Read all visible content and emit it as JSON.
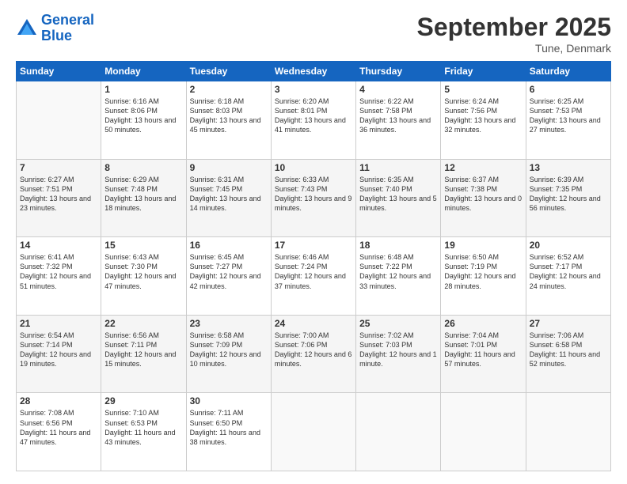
{
  "header": {
    "logo_line1": "General",
    "logo_line2": "Blue",
    "month": "September 2025",
    "location": "Tune, Denmark"
  },
  "days_of_week": [
    "Sunday",
    "Monday",
    "Tuesday",
    "Wednesday",
    "Thursday",
    "Friday",
    "Saturday"
  ],
  "weeks": [
    [
      {
        "day": "",
        "sunrise": "",
        "sunset": "",
        "daylight": ""
      },
      {
        "day": "1",
        "sunrise": "Sunrise: 6:16 AM",
        "sunset": "Sunset: 8:06 PM",
        "daylight": "Daylight: 13 hours and 50 minutes."
      },
      {
        "day": "2",
        "sunrise": "Sunrise: 6:18 AM",
        "sunset": "Sunset: 8:03 PM",
        "daylight": "Daylight: 13 hours and 45 minutes."
      },
      {
        "day": "3",
        "sunrise": "Sunrise: 6:20 AM",
        "sunset": "Sunset: 8:01 PM",
        "daylight": "Daylight: 13 hours and 41 minutes."
      },
      {
        "day": "4",
        "sunrise": "Sunrise: 6:22 AM",
        "sunset": "Sunset: 7:58 PM",
        "daylight": "Daylight: 13 hours and 36 minutes."
      },
      {
        "day": "5",
        "sunrise": "Sunrise: 6:24 AM",
        "sunset": "Sunset: 7:56 PM",
        "daylight": "Daylight: 13 hours and 32 minutes."
      },
      {
        "day": "6",
        "sunrise": "Sunrise: 6:25 AM",
        "sunset": "Sunset: 7:53 PM",
        "daylight": "Daylight: 13 hours and 27 minutes."
      }
    ],
    [
      {
        "day": "7",
        "sunrise": "Sunrise: 6:27 AM",
        "sunset": "Sunset: 7:51 PM",
        "daylight": "Daylight: 13 hours and 23 minutes."
      },
      {
        "day": "8",
        "sunrise": "Sunrise: 6:29 AM",
        "sunset": "Sunset: 7:48 PM",
        "daylight": "Daylight: 13 hours and 18 minutes."
      },
      {
        "day": "9",
        "sunrise": "Sunrise: 6:31 AM",
        "sunset": "Sunset: 7:45 PM",
        "daylight": "Daylight: 13 hours and 14 minutes."
      },
      {
        "day": "10",
        "sunrise": "Sunrise: 6:33 AM",
        "sunset": "Sunset: 7:43 PM",
        "daylight": "Daylight: 13 hours and 9 minutes."
      },
      {
        "day": "11",
        "sunrise": "Sunrise: 6:35 AM",
        "sunset": "Sunset: 7:40 PM",
        "daylight": "Daylight: 13 hours and 5 minutes."
      },
      {
        "day": "12",
        "sunrise": "Sunrise: 6:37 AM",
        "sunset": "Sunset: 7:38 PM",
        "daylight": "Daylight: 13 hours and 0 minutes."
      },
      {
        "day": "13",
        "sunrise": "Sunrise: 6:39 AM",
        "sunset": "Sunset: 7:35 PM",
        "daylight": "Daylight: 12 hours and 56 minutes."
      }
    ],
    [
      {
        "day": "14",
        "sunrise": "Sunrise: 6:41 AM",
        "sunset": "Sunset: 7:32 PM",
        "daylight": "Daylight: 12 hours and 51 minutes."
      },
      {
        "day": "15",
        "sunrise": "Sunrise: 6:43 AM",
        "sunset": "Sunset: 7:30 PM",
        "daylight": "Daylight: 12 hours and 47 minutes."
      },
      {
        "day": "16",
        "sunrise": "Sunrise: 6:45 AM",
        "sunset": "Sunset: 7:27 PM",
        "daylight": "Daylight: 12 hours and 42 minutes."
      },
      {
        "day": "17",
        "sunrise": "Sunrise: 6:46 AM",
        "sunset": "Sunset: 7:24 PM",
        "daylight": "Daylight: 12 hours and 37 minutes."
      },
      {
        "day": "18",
        "sunrise": "Sunrise: 6:48 AM",
        "sunset": "Sunset: 7:22 PM",
        "daylight": "Daylight: 12 hours and 33 minutes."
      },
      {
        "day": "19",
        "sunrise": "Sunrise: 6:50 AM",
        "sunset": "Sunset: 7:19 PM",
        "daylight": "Daylight: 12 hours and 28 minutes."
      },
      {
        "day": "20",
        "sunrise": "Sunrise: 6:52 AM",
        "sunset": "Sunset: 7:17 PM",
        "daylight": "Daylight: 12 hours and 24 minutes."
      }
    ],
    [
      {
        "day": "21",
        "sunrise": "Sunrise: 6:54 AM",
        "sunset": "Sunset: 7:14 PM",
        "daylight": "Daylight: 12 hours and 19 minutes."
      },
      {
        "day": "22",
        "sunrise": "Sunrise: 6:56 AM",
        "sunset": "Sunset: 7:11 PM",
        "daylight": "Daylight: 12 hours and 15 minutes."
      },
      {
        "day": "23",
        "sunrise": "Sunrise: 6:58 AM",
        "sunset": "Sunset: 7:09 PM",
        "daylight": "Daylight: 12 hours and 10 minutes."
      },
      {
        "day": "24",
        "sunrise": "Sunrise: 7:00 AM",
        "sunset": "Sunset: 7:06 PM",
        "daylight": "Daylight: 12 hours and 6 minutes."
      },
      {
        "day": "25",
        "sunrise": "Sunrise: 7:02 AM",
        "sunset": "Sunset: 7:03 PM",
        "daylight": "Daylight: 12 hours and 1 minute."
      },
      {
        "day": "26",
        "sunrise": "Sunrise: 7:04 AM",
        "sunset": "Sunset: 7:01 PM",
        "daylight": "Daylight: 11 hours and 57 minutes."
      },
      {
        "day": "27",
        "sunrise": "Sunrise: 7:06 AM",
        "sunset": "Sunset: 6:58 PM",
        "daylight": "Daylight: 11 hours and 52 minutes."
      }
    ],
    [
      {
        "day": "28",
        "sunrise": "Sunrise: 7:08 AM",
        "sunset": "Sunset: 6:56 PM",
        "daylight": "Daylight: 11 hours and 47 minutes."
      },
      {
        "day": "29",
        "sunrise": "Sunrise: 7:10 AM",
        "sunset": "Sunset: 6:53 PM",
        "daylight": "Daylight: 11 hours and 43 minutes."
      },
      {
        "day": "30",
        "sunrise": "Sunrise: 7:11 AM",
        "sunset": "Sunset: 6:50 PM",
        "daylight": "Daylight: 11 hours and 38 minutes."
      },
      {
        "day": "",
        "sunrise": "",
        "sunset": "",
        "daylight": ""
      },
      {
        "day": "",
        "sunrise": "",
        "sunset": "",
        "daylight": ""
      },
      {
        "day": "",
        "sunrise": "",
        "sunset": "",
        "daylight": ""
      },
      {
        "day": "",
        "sunrise": "",
        "sunset": "",
        "daylight": ""
      }
    ]
  ]
}
